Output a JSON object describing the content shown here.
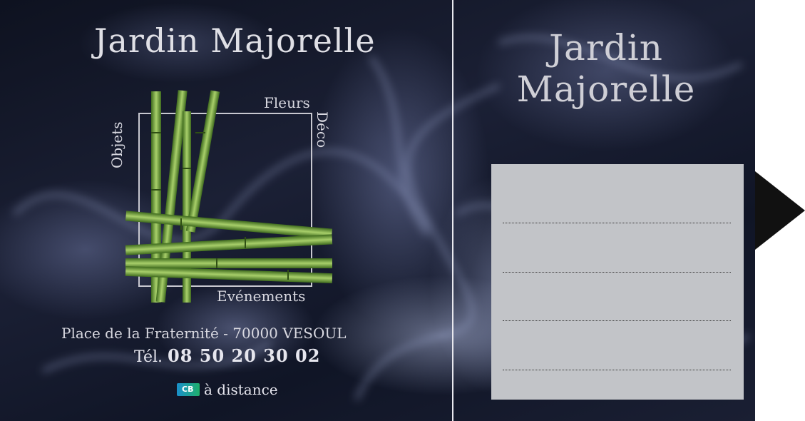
{
  "left_panel": {
    "title": "Jardin Majorelle",
    "logo": {
      "label_fleurs": "Fleurs",
      "label_deco": "Déco",
      "label_objets": "Objets",
      "label_evenements": "Evénements"
    },
    "address": "Place de la Fraternité - 70000 VESOUL",
    "phone_prefix": "Tél.",
    "phone_number": "08 50 20 30 02",
    "cb_badge": "CB",
    "payment_text": "à distance"
  },
  "right_panel": {
    "title_line1": "Jardin",
    "title_line2": "Majorelle",
    "write_lines": 4
  },
  "colors": {
    "background": "#151a2c",
    "text": "#e0e0e6",
    "panel": "#c2c4c8",
    "bamboo": "#6fa03a"
  }
}
